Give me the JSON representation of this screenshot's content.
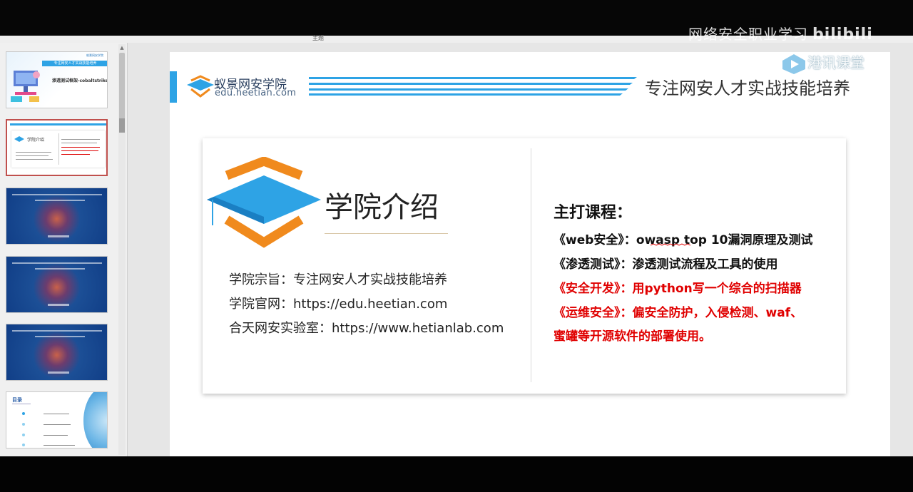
{
  "ribbon": {
    "label": "主题"
  },
  "watermark": {
    "text": "网络安全职业学习",
    "logo": "bilibili"
  },
  "thumbnails": {
    "t1": {
      "band": "专注网安人才实战技能培养",
      "title": "渗透测试框架-cobaltstrike",
      "logo": "蚁景网安学院"
    },
    "t2": {
      "title": "学院介绍"
    },
    "toc": {
      "title": "目录"
    }
  },
  "slide": {
    "brand": {
      "name": "蚁景网安学院",
      "url": "edu.heetian.com"
    },
    "slogan": "专注网安人才实战技能培养",
    "corner_brand": "港讯课堂",
    "intro_title": "学院介绍",
    "info": [
      "学院宗旨：专注网安人才实战技能培养",
      "学院官网：https://edu.heetian.com",
      "合天网安实验室：https://www.hetianlab.com"
    ],
    "courses": {
      "title": "主打课程：",
      "items": [
        {
          "text": "《web安全》：owasp top 10漏洞原理及测试",
          "color": "#111111"
        },
        {
          "text": "《渗透测试》：渗透测试流程及工具的使用",
          "color": "#111111"
        },
        {
          "text": "《安全开发》：用python写一个综合的扫描器",
          "color": "#e00000"
        },
        {
          "text": "《运维安全》：偏安全防护，入侵检测、waf、",
          "color": "#e00000"
        },
        {
          "text": "蜜罐等开源软件的部署使用。",
          "color": "#e00000"
        }
      ]
    }
  },
  "colors": {
    "accent_blue": "#2ea3e5",
    "accent_orange": "#f08a1d",
    "red_text": "#e00000"
  }
}
